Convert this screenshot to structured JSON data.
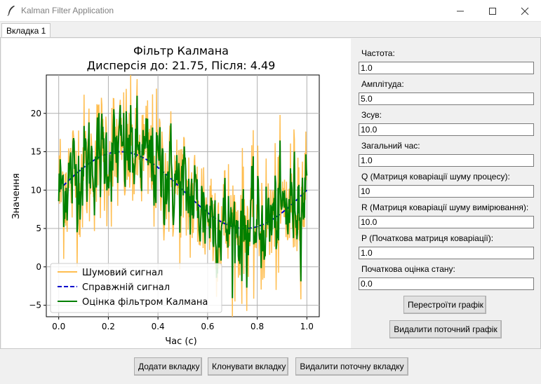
{
  "window": {
    "title": "Kalman Filter Application",
    "app_icon": "feather-icon"
  },
  "tabs": [
    {
      "label": "Вкладка 1",
      "active": true
    }
  ],
  "chart_data": {
    "type": "line",
    "title": "Фільтр Калмана",
    "subtitle": "Дисперсія до: 21.75, Після: 4.49",
    "xlabel": "Час (с)",
    "ylabel": "Значення",
    "xlim": [
      -0.05,
      1.05
    ],
    "ylim": [
      -6.5,
      25
    ],
    "xticks": [
      "0.0",
      "0.2",
      "0.4",
      "0.6",
      "0.8",
      "1.0"
    ],
    "xtick_values": [
      0.0,
      0.2,
      0.4,
      0.6,
      0.8,
      1.0
    ],
    "yticks": [
      "−5",
      "0",
      "5",
      "10",
      "15",
      "20"
    ],
    "ytick_values": [
      -5,
      0,
      5,
      10,
      15,
      20
    ],
    "grid": true,
    "legend_position": "lower-left",
    "true_signal": {
      "amplitude": 5.0,
      "frequency": 1.0,
      "offset": 10.0,
      "duration": 1.0
    },
    "series": [
      {
        "name": "Шумовий сигнал",
        "color": "#ffbe50",
        "style": "solid",
        "kind": "noisy"
      },
      {
        "name": "Справжній сигнал",
        "color": "#0000cc",
        "style": "dashed",
        "kind": "true"
      },
      {
        "name": "Оцінка фільтром Калмана",
        "color": "#008000",
        "style": "solid",
        "kind": "estimate"
      }
    ]
  },
  "params": [
    {
      "label": "Частота:",
      "value": "1.0"
    },
    {
      "label": "Амплітуда:",
      "value": "5.0"
    },
    {
      "label": "Зсув:",
      "value": "10.0"
    },
    {
      "label": "Загальний час:",
      "value": "1.0"
    },
    {
      "label": "Q (Матриця коваріації шуму процесу):",
      "value": "10"
    },
    {
      "label": "R (Матриця коваріації шуму вимірювання):",
      "value": "10.0"
    },
    {
      "label": "P (Початкова матриця коваріації):",
      "value": "1.0"
    },
    {
      "label": "Початкова оцінка стану:",
      "value": "0.0"
    }
  ],
  "buttons": {
    "rebuild": "Перестроїти графік",
    "delete_plot": "Видалити поточний графік",
    "add_tab": "Додати вкладку",
    "clone_tab": "Клонувати вкладку",
    "delete_tab": "Видалити поточну вкладку"
  }
}
